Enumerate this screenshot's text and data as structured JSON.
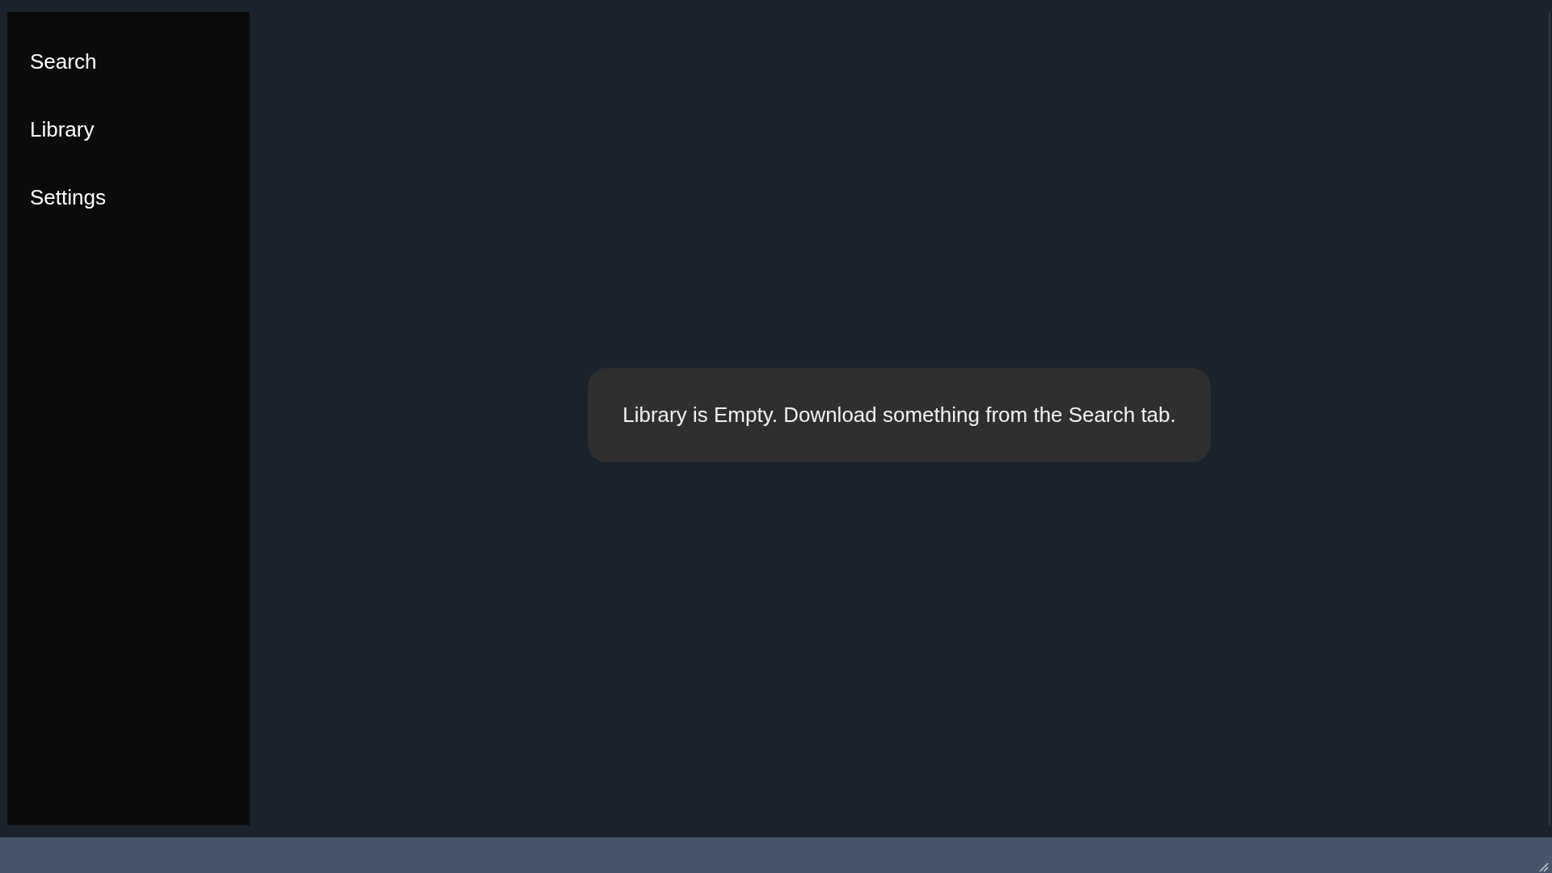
{
  "sidebar": {
    "items": [
      {
        "label": "Search"
      },
      {
        "label": "Library"
      },
      {
        "label": "Settings"
      }
    ]
  },
  "main": {
    "empty_message": "Library is Empty. Download something from the Search tab."
  }
}
